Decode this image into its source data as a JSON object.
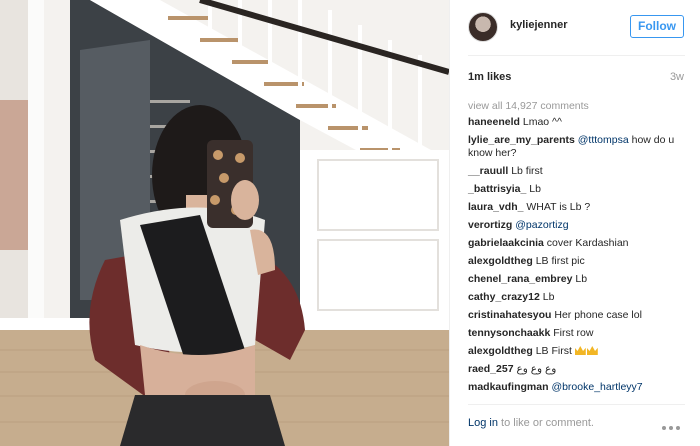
{
  "post": {
    "username": "kyliejenner",
    "follow_label": "Follow",
    "likes": "1m likes",
    "time": "3w",
    "view_all": "view all 14,927 comments",
    "comments": [
      {
        "user": "haneeneld",
        "text": "Lmao ^^"
      },
      {
        "user": "lylie_are_my_parents",
        "mention": "@tttompsa",
        "text": " how do u know her?"
      },
      {
        "user": "__rauull",
        "text": "Lb first"
      },
      {
        "user": "_battrisyia_",
        "text": "Lb"
      },
      {
        "user": "laura_vdh_",
        "text": "WHAT is Lb ?"
      },
      {
        "user": "verortizg",
        "mention": "@pazortizg",
        "text": ""
      },
      {
        "user": "gabrielaakcinia",
        "text": "cover Kardashian"
      },
      {
        "user": "alexgoldtheg",
        "text": "LB first pic"
      },
      {
        "user": "chenel_rana_embrey",
        "text": "Lb"
      },
      {
        "user": "cathy_crazy12",
        "text": "Lb"
      },
      {
        "user": "cristinahatesyou",
        "text": "Her phone case lol"
      },
      {
        "user": "tennysonchaakk",
        "text": "First row"
      },
      {
        "user": "alexgoldtheg",
        "text": "LB First",
        "emoji": "crown-crown"
      },
      {
        "user": "raed_257",
        "text": "وع وع وع"
      },
      {
        "user": "madkaufingman",
        "mention": "@brooke_hartleyy7",
        "text": ""
      }
    ],
    "login_link": "Log in",
    "login_rest": " to like or comment.",
    "more_icon": "ellipsis-icon"
  },
  "colors": {
    "accent": "#3897f0",
    "link": "#003569",
    "muted": "#999999",
    "crown": "#f2b625"
  }
}
